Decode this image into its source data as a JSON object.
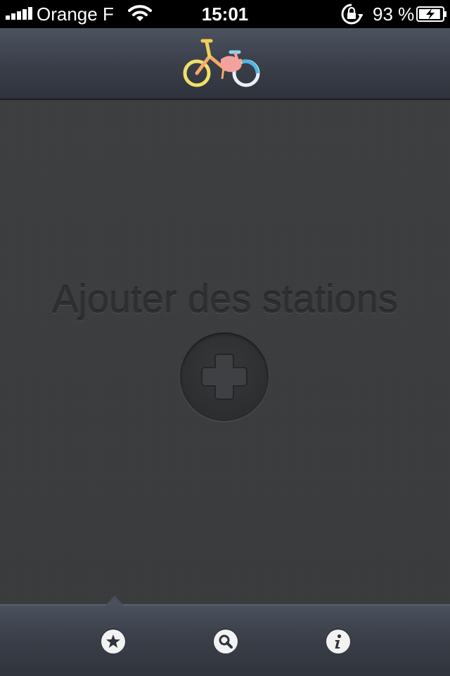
{
  "status_bar": {
    "carrier": "Orange F",
    "time": "15:01",
    "battery_percent": "93 %",
    "signal_bars": 5,
    "battery_level": 0.93
  },
  "nav_bar": {
    "logo_icon": "bicycle-logo-icon"
  },
  "main": {
    "empty_title": "Ajouter des stations",
    "add_icon": "plus-icon"
  },
  "tab_bar": {
    "selected_index": 0,
    "tabs": [
      {
        "icon": "star-icon"
      },
      {
        "icon": "search-icon"
      },
      {
        "icon": "info-icon"
      }
    ]
  },
  "colors": {
    "background": "#3a3b3d",
    "bar": "#3a3f4a",
    "status_bar": "#000000"
  }
}
